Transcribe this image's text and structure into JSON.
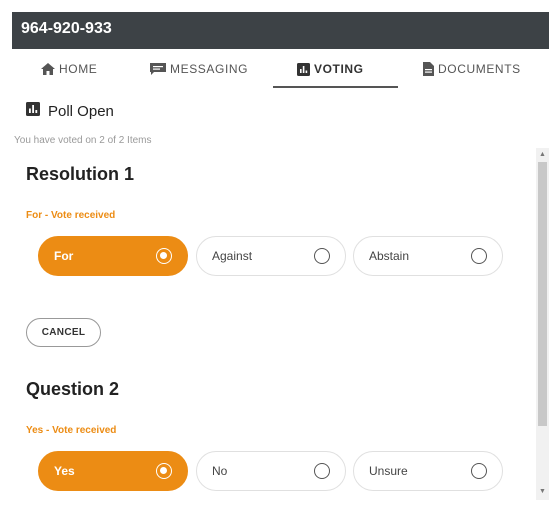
{
  "header": {
    "title": "964-920-933"
  },
  "tabs": [
    {
      "label": "HOME",
      "icon": "home-icon"
    },
    {
      "label": "MESSAGING",
      "icon": "chat-icon"
    },
    {
      "label": "VOTING",
      "icon": "bar-chart-icon",
      "active": true
    },
    {
      "label": "DOCUMENTS",
      "icon": "document-icon"
    }
  ],
  "poll": {
    "status": "Poll Open",
    "progress": "You have voted on 2 of 2 Items"
  },
  "items": [
    {
      "title": "Resolution 1",
      "vote_status": "For - Vote received",
      "options": [
        {
          "label": "For",
          "selected": true
        },
        {
          "label": "Against",
          "selected": false
        },
        {
          "label": "Abstain",
          "selected": false
        }
      ],
      "cancel_label": "CANCEL"
    },
    {
      "title": "Question 2",
      "vote_status": "Yes - Vote received",
      "options": [
        {
          "label": "Yes",
          "selected": true
        },
        {
          "label": "No",
          "selected": false
        },
        {
          "label": "Unsure",
          "selected": false
        }
      ]
    }
  ],
  "colors": {
    "accent": "#ec8c14",
    "header_bg": "#3d4246"
  }
}
